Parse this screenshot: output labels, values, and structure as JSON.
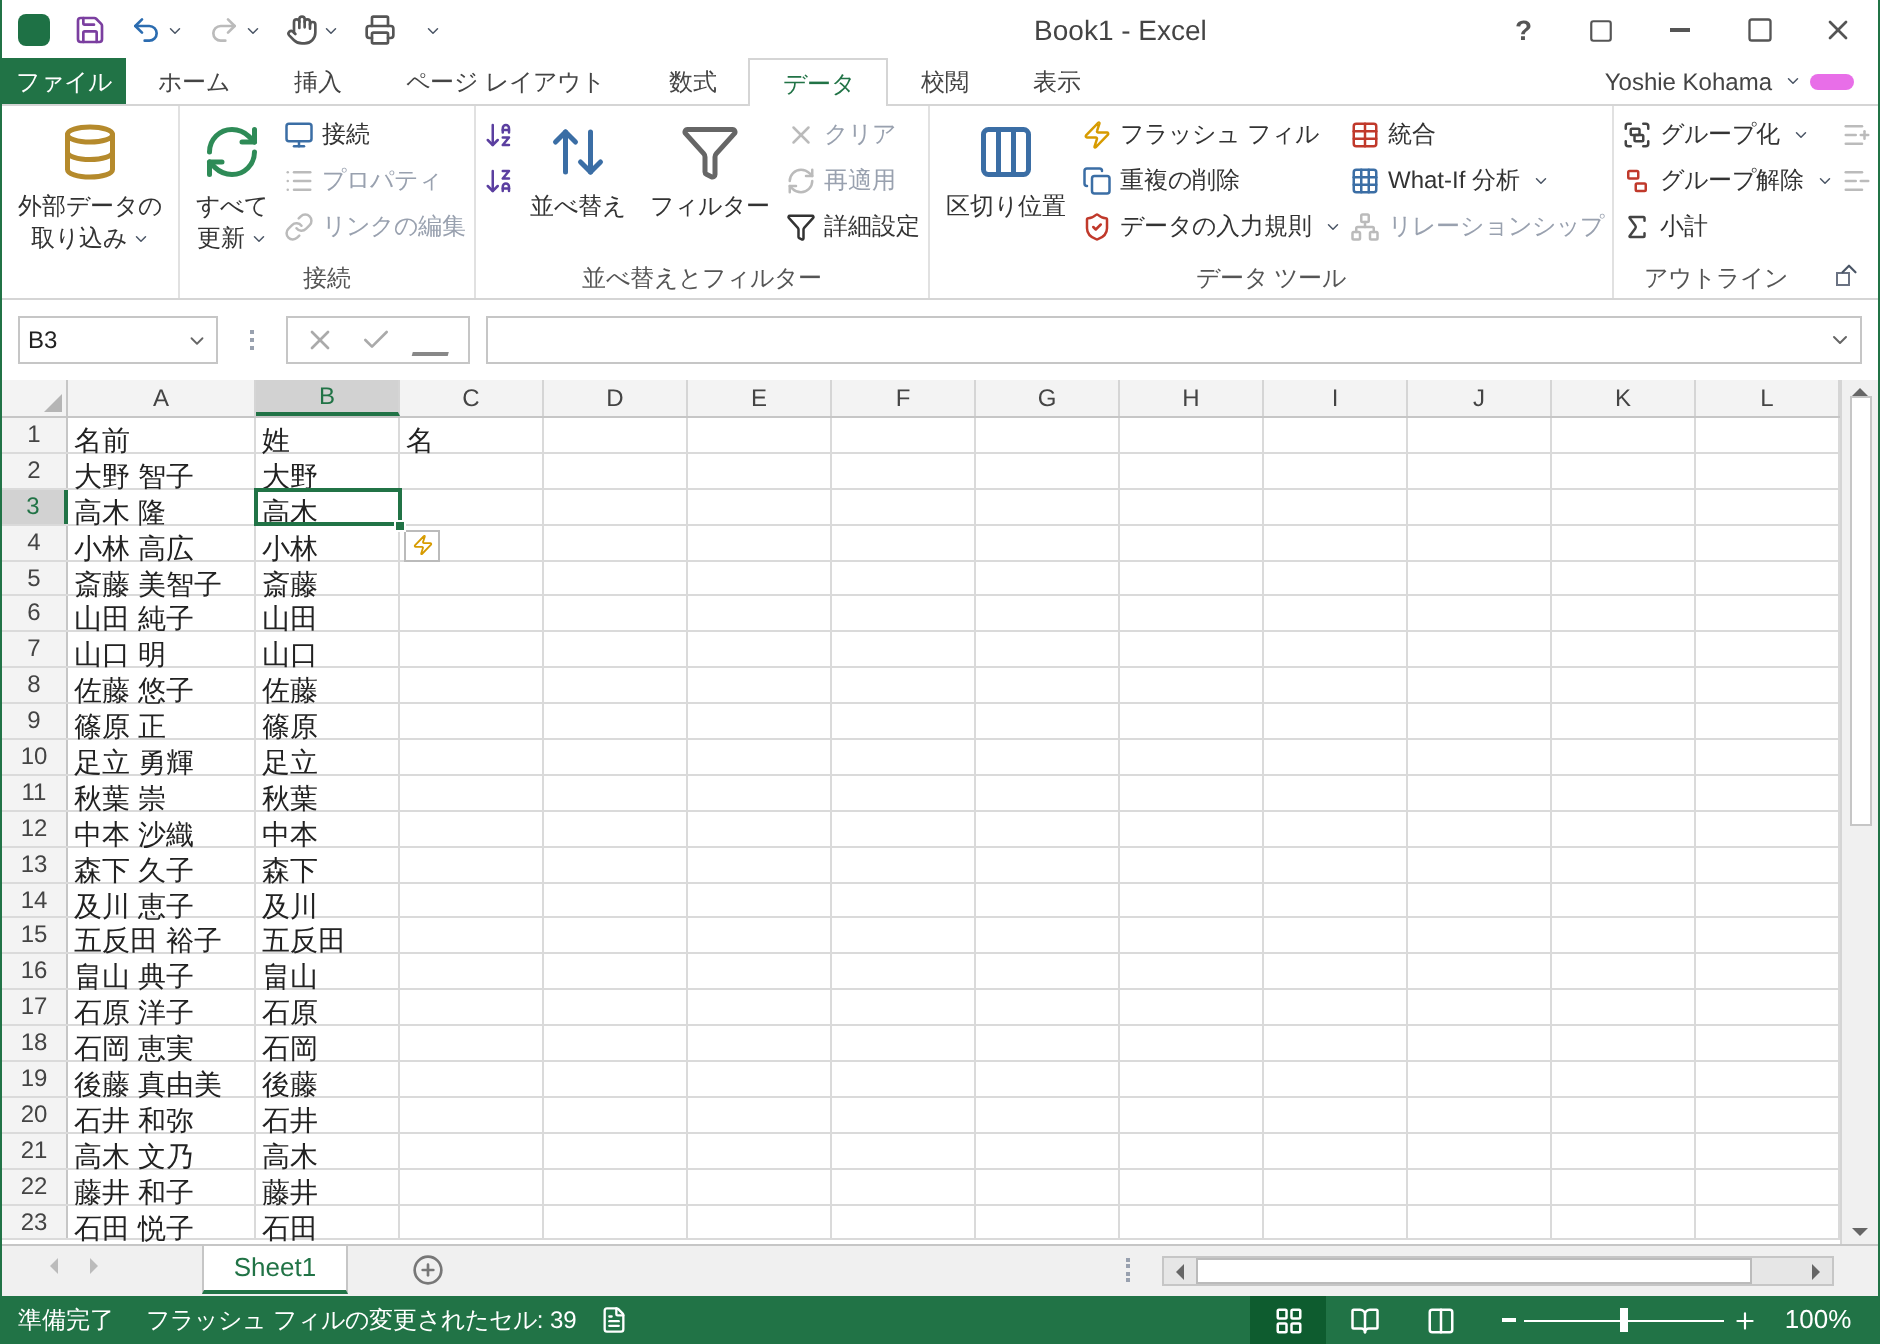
{
  "window": {
    "title": "Book1 - Excel",
    "help": "?"
  },
  "tabs": [
    {
      "label": "ファイル",
      "kind": "file",
      "selected": false
    },
    {
      "label": "ホーム",
      "kind": "tab",
      "selected": false
    },
    {
      "label": "挿入",
      "kind": "tab",
      "selected": false
    },
    {
      "label": "ページ レイアウト",
      "kind": "tab",
      "selected": false
    },
    {
      "label": "数式",
      "kind": "tab",
      "selected": false
    },
    {
      "label": "データ",
      "kind": "tab",
      "selected": true
    },
    {
      "label": "校閲",
      "kind": "tab",
      "selected": false
    },
    {
      "label": "表示",
      "kind": "tab",
      "selected": false
    }
  ],
  "user": {
    "name": "Yoshie Kohama"
  },
  "ribbon": [
    {
      "columns": [
        {
          "kind": "large",
          "lines": [
            "外部データの",
            "取り込み"
          ],
          "dropdown": true,
          "disabled": false
        }
      ]
    },
    {
      "label": "接続",
      "columns": [
        {
          "kind": "large",
          "lines": [
            "すべて",
            "更新"
          ],
          "dropdown": true,
          "disabled": false
        },
        {
          "kind": "stack",
          "items": [
            {
              "label": "接続",
              "disabled": false,
              "dropdown": false
            },
            {
              "label": "プロパティ",
              "disabled": true,
              "dropdown": false
            },
            {
              "label": "リンクの編集",
              "disabled": true,
              "dropdown": false
            }
          ]
        }
      ]
    },
    {
      "label": "並べ替えとフィルター",
      "columns": [
        {
          "kind": "stack",
          "items": [
            {
              "disabled": false,
              "dropdown": false
            },
            {
              "disabled": false,
              "dropdown": false
            }
          ]
        },
        {
          "kind": "large",
          "lines": [
            "並べ替え"
          ],
          "dropdown": false,
          "disabled": false
        },
        {
          "kind": "large",
          "lines": [
            "フィルター"
          ],
          "dropdown": false,
          "disabled": false
        },
        {
          "kind": "stack",
          "items": [
            {
              "label": "クリア",
              "disabled": true,
              "dropdown": false
            },
            {
              "label": "再適用",
              "disabled": true,
              "dropdown": false
            },
            {
              "label": "詳細設定",
              "disabled": false,
              "dropdown": false
            }
          ]
        }
      ]
    },
    {
      "label": "データ ツール",
      "columns": [
        {
          "kind": "large",
          "lines": [
            "区切り位置"
          ],
          "dropdown": false,
          "disabled": false
        },
        {
          "kind": "stack",
          "items": [
            {
              "label": "フラッシュ フィル",
              "disabled": false,
              "dropdown": false
            },
            {
              "label": "重複の削除",
              "disabled": false,
              "dropdown": false
            },
            {
              "label": "データの入力規則",
              "disabled": false,
              "dropdown": true
            }
          ]
        },
        {
          "kind": "stack",
          "items": [
            {
              "label": "統合",
              "disabled": false,
              "dropdown": false
            },
            {
              "label": "What-If 分析",
              "disabled": false,
              "dropdown": true
            },
            {
              "label": "リレーションシップ",
              "disabled": true,
              "dropdown": false
            }
          ]
        }
      ]
    },
    {
      "label": "アウトライン",
      "launcher": true,
      "columns": [
        {
          "kind": "stack",
          "items": [
            {
              "label": "グループ化",
              "disabled": false,
              "dropdown": true
            },
            {
              "label": "グループ解除",
              "disabled": false,
              "dropdown": true
            },
            {
              "label": "小計",
              "disabled": false,
              "dropdown": false
            }
          ]
        },
        {
          "kind": "stack",
          "items": [
            {
              "disabled": true,
              "dropdown": false
            },
            {
              "disabled": true,
              "dropdown": false
            }
          ]
        }
      ]
    }
  ],
  "formula_bar": {
    "name_box": "B3"
  },
  "columns": [
    {
      "label": "A",
      "selected": false
    },
    {
      "label": "B",
      "selected": true
    },
    {
      "label": "C",
      "selected": false
    },
    {
      "label": "D",
      "selected": false
    },
    {
      "label": "E",
      "selected": false
    },
    {
      "label": "F",
      "selected": false
    },
    {
      "label": "G",
      "selected": false
    },
    {
      "label": "H",
      "selected": false
    },
    {
      "label": "I",
      "selected": false
    },
    {
      "label": "J",
      "selected": false
    },
    {
      "label": "K",
      "selected": false
    },
    {
      "label": "L",
      "selected": false
    }
  ],
  "rows": [
    {
      "number": "1",
      "selected": false,
      "cells": [
        "名前",
        "姓",
        "名"
      ]
    },
    {
      "number": "2",
      "selected": false,
      "cells": [
        "大野 智子",
        "大野"
      ]
    },
    {
      "number": "3",
      "selected": true,
      "cells": [
        "高木 隆",
        "高木"
      ]
    },
    {
      "number": "4",
      "selected": false,
      "cells": [
        "小林 高広",
        "小林"
      ],
      "flash_fill_options": true
    },
    {
      "number": "5",
      "selected": false,
      "cells": [
        "斎藤 美智子",
        "斎藤"
      ]
    },
    {
      "number": "6",
      "selected": false,
      "cells": [
        "山田 純子",
        "山田"
      ]
    },
    {
      "number": "7",
      "selected": false,
      "cells": [
        "山口 明",
        "山口"
      ]
    },
    {
      "number": "8",
      "selected": false,
      "cells": [
        "佐藤 悠子",
        "佐藤"
      ]
    },
    {
      "number": "9",
      "selected": false,
      "cells": [
        "篠原 正",
        "篠原"
      ]
    },
    {
      "number": "10",
      "selected": false,
      "cells": [
        "足立 勇輝",
        "足立"
      ]
    },
    {
      "number": "11",
      "selected": false,
      "cells": [
        "秋葉 崇",
        "秋葉"
      ]
    },
    {
      "number": "12",
      "selected": false,
      "cells": [
        "中本 沙織",
        "中本"
      ]
    },
    {
      "number": "13",
      "selected": false,
      "cells": [
        "森下 久子",
        "森下"
      ]
    },
    {
      "number": "14",
      "selected": false,
      "cells": [
        "及川 恵子",
        "及川"
      ]
    },
    {
      "number": "15",
      "selected": false,
      "cells": [
        "五反田 裕子",
        "五反田"
      ]
    },
    {
      "number": "16",
      "selected": false,
      "cells": [
        "畠山 典子",
        "畠山"
      ]
    },
    {
      "number": "17",
      "selected": false,
      "cells": [
        "石原 洋子",
        "石原"
      ]
    },
    {
      "number": "18",
      "selected": false,
      "cells": [
        "石岡 恵実",
        "石岡"
      ]
    },
    {
      "number": "19",
      "selected": false,
      "cells": [
        "後藤 真由美",
        "後藤"
      ]
    },
    {
      "number": "20",
      "selected": false,
      "cells": [
        "石井 和弥",
        "石井"
      ]
    },
    {
      "number": "21",
      "selected": false,
      "cells": [
        "高木 文乃",
        "高木"
      ]
    },
    {
      "number": "22",
      "selected": false,
      "cells": [
        "藤井 和子",
        "藤井"
      ]
    },
    {
      "number": "23",
      "selected": false,
      "cells": [
        "石田 悦子",
        "石田"
      ]
    }
  ],
  "sheets": [
    {
      "label": "Sheet1",
      "selected": true
    }
  ],
  "status_bar": {
    "ready": "準備完了",
    "message": "フラッシュ フィルの変更されたセル: 39",
    "views": [
      {
        "kind": "normal",
        "selected": true
      },
      {
        "kind": "layout",
        "selected": false
      },
      {
        "kind": "pagebreak",
        "selected": false
      }
    ],
    "zoom": {
      "level": 0.5,
      "reading": "100%"
    }
  }
}
